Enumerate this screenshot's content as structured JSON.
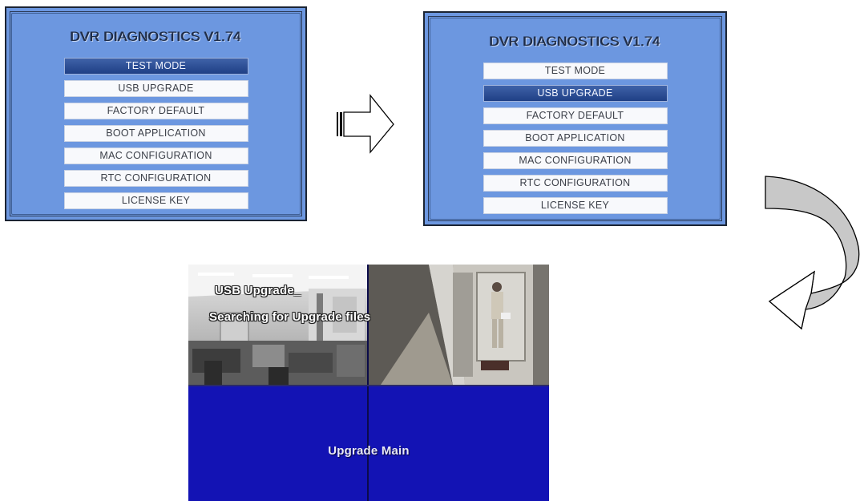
{
  "left_screen": {
    "title": "DVR DIAGNOSTICS V1.74",
    "menu": [
      {
        "label": "TEST MODE",
        "selected": true
      },
      {
        "label": "USB UPGRADE",
        "selected": false
      },
      {
        "label": "FACTORY DEFAULT",
        "selected": false
      },
      {
        "label": "BOOT APPLICATION",
        "selected": false
      },
      {
        "label": "MAC CONFIGURATION",
        "selected": false
      },
      {
        "label": "RTC CONFIGURATION",
        "selected": false
      },
      {
        "label": "LICENSE KEY",
        "selected": false
      }
    ]
  },
  "right_screen": {
    "title": "DVR DIAGNOSTICS V1.74",
    "menu": [
      {
        "label": "TEST MODE",
        "selected": false
      },
      {
        "label": "USB UPGRADE",
        "selected": true
      },
      {
        "label": "FACTORY DEFAULT",
        "selected": false
      },
      {
        "label": "BOOT APPLICATION",
        "selected": false
      },
      {
        "label": "MAC CONFIGURATION",
        "selected": false
      },
      {
        "label": "RTC CONFIGURATION",
        "selected": false
      },
      {
        "label": "LICENSE KEY",
        "selected": false
      }
    ]
  },
  "camera_screen": {
    "osd_title": "USB Upgrade_",
    "osd_status": "Searching for Upgrade files",
    "upgrade_label": "Upgrade Main"
  },
  "colors": {
    "panel_bg": "#6c97e0",
    "selected_item": "#2a4c95",
    "camera_blue": "#1313b4"
  },
  "icons": {
    "right_arrow": "hollow-right-arrow-icon",
    "curved_arrow": "curved-down-left-arrow-icon"
  }
}
